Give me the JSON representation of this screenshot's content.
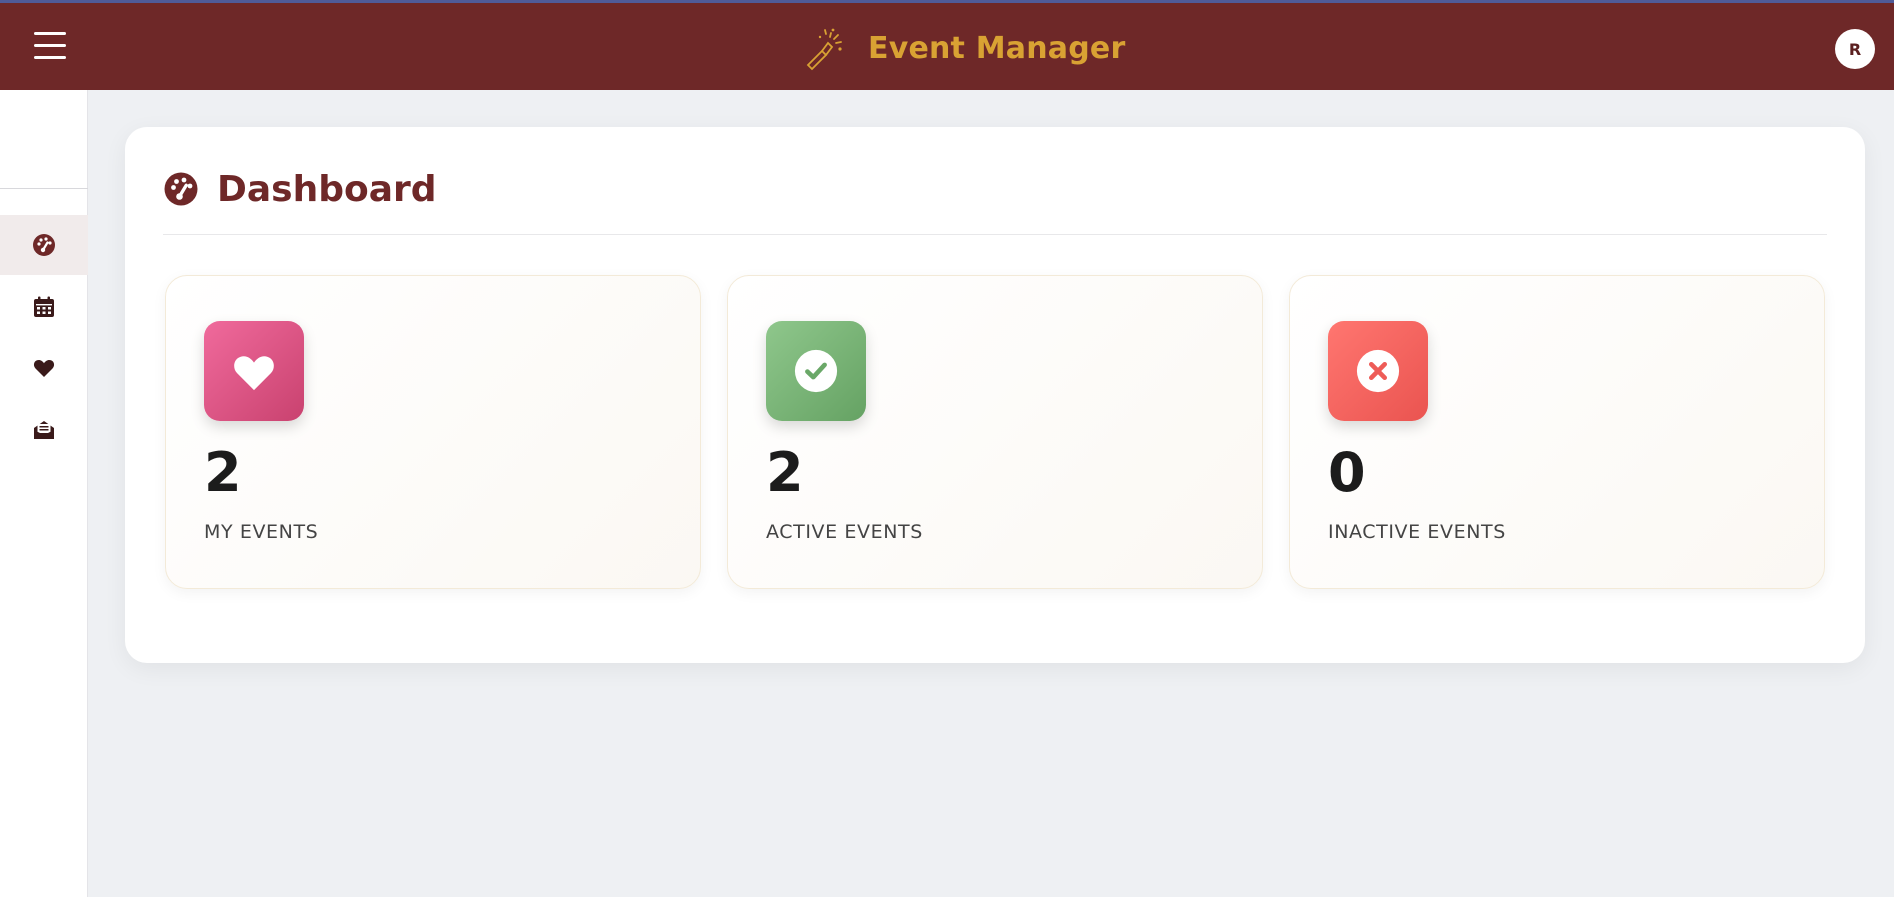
{
  "header": {
    "app_title": "Event Manager",
    "user_initial": "R",
    "brand_color": "#d9a233",
    "bar_color": "#6e2828"
  },
  "sidebar": {
    "items": [
      {
        "icon": "dashboard-gauge-icon",
        "active": true
      },
      {
        "icon": "calendar-icon",
        "active": false
      },
      {
        "icon": "heart-icon",
        "active": false
      },
      {
        "icon": "envelope-open-icon",
        "active": false
      }
    ]
  },
  "main": {
    "title": "Dashboard",
    "title_icon": "dashboard-gauge-icon",
    "stats": [
      {
        "value": "2",
        "label": "MY EVENTS",
        "icon": "heart-icon",
        "color": "#e0528a"
      },
      {
        "value": "2",
        "label": "ACTIVE EVENTS",
        "icon": "check-circle-icon",
        "color": "#78b277"
      },
      {
        "value": "0",
        "label": "INACTIVE EVENTS",
        "icon": "x-circle-icon",
        "color": "#f26762"
      }
    ]
  }
}
